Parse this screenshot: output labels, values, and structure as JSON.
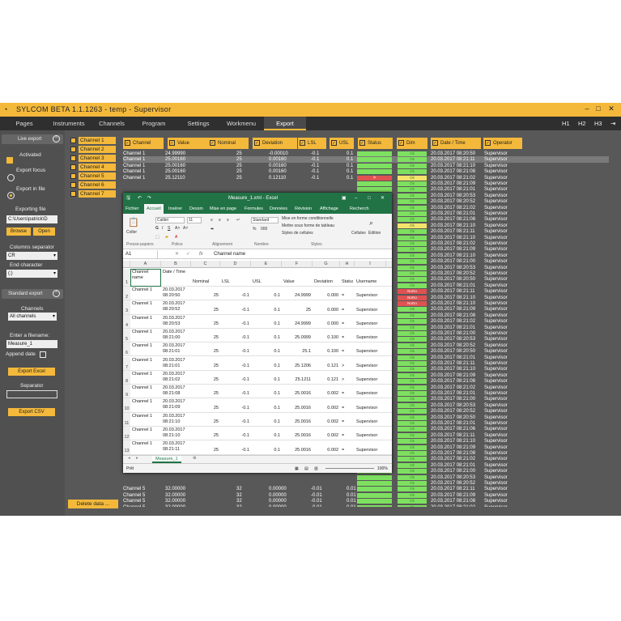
{
  "app": {
    "title": "SYLCOM BETA 1.1.1263  - temp - Supervisor"
  },
  "menu": {
    "items": [
      "Pages",
      "Instruments",
      "Channels",
      "Program",
      "Settings",
      "Workmenu",
      "Export"
    ],
    "active": "Export",
    "right": [
      "H1",
      "H2",
      "H3"
    ]
  },
  "left": {
    "live_export": "Live export",
    "activated": "Activated",
    "export_focus": "Export focus",
    "export_in_file": "Export in file",
    "exporting_file": "Exporting file",
    "file_path": "C:\\Users\\patrick\\D",
    "browse": "Browse",
    "open": "Open",
    "columns_separator": "Columns separator",
    "columns_value": "CR",
    "end_character": "End character",
    "end_value": "(;)",
    "standard_export": "Standard export",
    "channels": "Channels",
    "channels_value": "All channels",
    "enter_filename": "Enter a filename:",
    "filename": "Measure_1",
    "append_date": "Append date",
    "export_excel": "Export Excel",
    "separator": "Separator",
    "export_csv": "Export CSV"
  },
  "channels": [
    "Channel 1",
    "Channel 2",
    "Channel 3",
    "Channel 4",
    "Channel 5",
    "Channel 6",
    "Channel 7"
  ],
  "delete_button": "Delete data ...",
  "grid": {
    "headers": [
      "Channel",
      "Value",
      "Nominal",
      "Deviation",
      "LSL",
      "USL",
      "Status",
      "Dim",
      "Date / Time",
      "Operator"
    ],
    "top_rows": [
      [
        "Channel 1",
        "24.99990",
        "25",
        "-0.00010",
        "-0.1",
        "0.1",
        "ok",
        "20.03.2017 08:20:50",
        "Supervisor"
      ],
      [
        "Channel 1",
        "25.00160",
        "25",
        "0.00160",
        "-0.1",
        "0.1",
        "ok",
        "20.03.2017 08:21:11",
        "Supervisor"
      ],
      [
        "Channel 1",
        "25.00160",
        "25",
        "0.00160",
        "-0.1",
        "0.1",
        "ok",
        "20.03.2017 08:21:10",
        "Supervisor"
      ],
      [
        "Channel 1",
        "25.00160",
        "25",
        "0.00160",
        "-0.1",
        "0.1",
        "ok",
        "20.03.2017 08:21:08",
        "Supervisor"
      ],
      [
        "Channel 1",
        "25.12110",
        "25",
        "0.12110",
        "-0.1",
        "0.1",
        ">",
        "20.03.2017 08:21:02",
        "Supervisor"
      ]
    ],
    "status_gt": ">",
    "dim_ok": "Ok",
    "dim_nogo": "NoGo",
    "right_rows": [
      [
        "20.03.2017 08:21:09",
        "Supervisor"
      ],
      [
        "20.03.2017 08:21:01",
        "Supervisor"
      ],
      [
        "20.03.2017 08:20:53",
        "Supervisor"
      ],
      [
        "20.03.2017 08:20:52",
        "Supervisor"
      ],
      [
        "20.03.2017 08:21:02",
        "Supervisor"
      ],
      [
        "20.03.2017 08:21:01",
        "Supervisor"
      ],
      [
        "20.03.2017 08:21:08",
        "Supervisor"
      ],
      [
        "20.03.2017 08:21:10",
        "Supervisor"
      ],
      [
        "20.03.2017 08:21:11",
        "Supervisor"
      ],
      [
        "20.03.2017 08:21:10",
        "Supervisor"
      ],
      [
        "20.03.2017 08:21:02",
        "Supervisor"
      ],
      [
        "20.03.2017 08:21:09",
        "Supervisor"
      ],
      [
        "20.03.2017 08:21:10",
        "Supervisor"
      ],
      [
        "20.03.2017 08:21:00",
        "Supervisor"
      ],
      [
        "20.03.2017 08:20:53",
        "Supervisor"
      ],
      [
        "20.03.2017 08:20:52",
        "Supervisor"
      ],
      [
        "20.03.2017 08:20:50",
        "Supervisor"
      ],
      [
        "20.03.2017 08:21:01",
        "Supervisor"
      ],
      [
        "20.03.2017 08:21:11",
        "Supervisor"
      ],
      [
        "20.03.2017 08:21:10",
        "Supervisor"
      ],
      [
        "20.03.2017 08:21:10",
        "Supervisor"
      ],
      [
        "20.03.2017 08:21:09",
        "Supervisor"
      ],
      [
        "20.03.2017 08:21:08",
        "Supervisor"
      ],
      [
        "20.03.2017 08:21:02",
        "Supervisor"
      ],
      [
        "20.03.2017 08:21:01",
        "Supervisor"
      ],
      [
        "20.03.2017 08:21:00",
        "Supervisor"
      ],
      [
        "20.03.2017 08:20:53",
        "Supervisor"
      ],
      [
        "20.03.2017 08:20:52",
        "Supervisor"
      ],
      [
        "20.03.2017 08:20:50",
        "Supervisor"
      ],
      [
        "20.03.2017 08:21:01",
        "Supervisor"
      ],
      [
        "20.03.2017 08:21:11",
        "Supervisor"
      ],
      [
        "20.03.2017 08:21:10",
        "Supervisor"
      ],
      [
        "20.03.2017 08:21:09",
        "Supervisor"
      ],
      [
        "20.03.2017 08:21:08",
        "Supervisor"
      ],
      [
        "20.03.2017 08:21:02",
        "Supervisor"
      ],
      [
        "20.03.2017 08:21:01",
        "Supervisor"
      ],
      [
        "20.03.2017 08:21:00",
        "Supervisor"
      ],
      [
        "20.03.2017 08:20:53",
        "Supervisor"
      ],
      [
        "20.03.2017 08:20:52",
        "Supervisor"
      ],
      [
        "20.03.2017 08:20:50",
        "Supervisor"
      ],
      [
        "20.03.2017 08:21:01",
        "Supervisor"
      ],
      [
        "20.03.2017 08:21:06",
        "Supervisor"
      ],
      [
        "20.03.2017 08:21:11",
        "Supervisor"
      ],
      [
        "20.03.2017 08:21:10",
        "Supervisor"
      ],
      [
        "20.03.2017 08:21:09",
        "Supervisor"
      ],
      [
        "20.03.2017 08:21:08",
        "Supervisor"
      ],
      [
        "20.03.2017 08:21:02",
        "Supervisor"
      ],
      [
        "20.03.2017 08:21:01",
        "Supervisor"
      ],
      [
        "20.03.2017 08:21:00",
        "Supervisor"
      ],
      [
        "20.03.2017 08:20:53",
        "Supervisor"
      ],
      [
        "20.03.2017 08:20:52",
        "Supervisor"
      ]
    ],
    "bottom_rows": [
      [
        "Channel 5",
        "32.00000",
        "32",
        "0.00000",
        "-0.01",
        "0.01",
        "20.03.2017 08:21:11",
        "Supervisor"
      ],
      [
        "Channel 5",
        "32.00000",
        "32",
        "0.00000",
        "-0.01",
        "0.01",
        "20.03.2017 08:21:09",
        "Supervisor"
      ],
      [
        "Channel 5",
        "32.00000",
        "32",
        "0.00000",
        "-0.01",
        "0.01",
        "20.03.2017 08:21:08",
        "Supervisor"
      ],
      [
        "Channel 5",
        "32.00000",
        "32",
        "0.00000",
        "-0.01",
        "0.01",
        "20.03.2017 08:21:02",
        "Supervisor"
      ],
      [
        "Channel 5",
        "32.00000",
        "32",
        "0.00000",
        "-0.01",
        "0.01",
        "20.03.2017 08:21:01",
        "Supervisor"
      ],
      [
        "Channel 5",
        "32.00000",
        "32",
        "0.00000",
        "-0.01",
        "0.01",
        "20.03.2017 08:21:00",
        "Supervisor"
      ]
    ]
  },
  "excel": {
    "title": "Measure_1.xml - Excel",
    "tabs": [
      "Fichier",
      "Accueil",
      "Insérer",
      "Dessin",
      "Mise en page",
      "Formules",
      "Données",
      "Révision",
      "Affichage",
      "Recherch"
    ],
    "active_tab": "Accueil",
    "ribbon": {
      "paste": "Coller",
      "font": "Calibri",
      "size": "11",
      "format": "Standard",
      "cond": "Mise en forme conditionnelle",
      "table": "Mettre sous forme de tableau",
      "styles_btn": "Styles de cellules",
      "cells": "Cellules",
      "edit": "Édition",
      "g_clipboard": "Presse-papiers",
      "g_font": "Police",
      "g_align": "Alignement",
      "g_number": "Nombre",
      "g_styles": "Styles"
    },
    "cell_ref": "A1",
    "formula": "Channel name",
    "cols": [
      "A",
      "B",
      "C",
      "D",
      "E",
      "F",
      "G",
      "H",
      "I"
    ],
    "header": [
      "Channel name",
      "Date / Time",
      "Nominal",
      "LSL",
      "USL",
      "Value",
      "Deviation",
      "Status",
      "Username"
    ],
    "rows": [
      [
        "Channel 1",
        "20.03.2017 08:20:50",
        "25",
        "-0.1",
        "0.1",
        "24.9999",
        "0.000",
        "=",
        "Supervisor"
      ],
      [
        "Channel 1",
        "20.03.2017 08:20:52",
        "25",
        "-0.1",
        "0.1",
        "25",
        "0.000",
        "=",
        "Supervisor"
      ],
      [
        "Channel 1",
        "20.03.2017 08:20:53",
        "25",
        "-0.1",
        "0.1",
        "24.9999",
        "0.000",
        "=",
        "Supervisor"
      ],
      [
        "Channel 1",
        "20.03.2017 08:21:00",
        "25",
        "-0.1",
        "0.1",
        "25.0999",
        "0.100",
        "=",
        "Supervisor"
      ],
      [
        "Channel 1",
        "20.03.2017 08:21:01",
        "25",
        "-0.1",
        "0.1",
        "25.1",
        "0.100",
        "=",
        "Supervisor"
      ],
      [
        "Channel 1",
        "20.03.2017 08:21:01",
        "25",
        "-0.1",
        "0.1",
        "25.1206",
        "0.121",
        ">",
        "Supervisor"
      ],
      [
        "Channel 1",
        "20.03.2017 08:21:02",
        "25",
        "-0.1",
        "0.1",
        "25.1211",
        "0.121",
        ">",
        "Supervisor"
      ],
      [
        "Channel 1",
        "20.03.2017 08:21:08",
        "25",
        "-0.1",
        "0.1",
        "25.0016",
        "0.002",
        "=",
        "Supervisor"
      ],
      [
        "Channel 1",
        "20.03.2017 08:21:09",
        "25",
        "-0.1",
        "0.1",
        "25.0016",
        "0.002",
        "=",
        "Supervisor"
      ],
      [
        "Channel 1",
        "20.03.2017 08:21:10",
        "25",
        "-0.1",
        "0.1",
        "25.0016",
        "0.002",
        "=",
        "Supervisor"
      ],
      [
        "Channel 1",
        "20.03.2017 08:21:10",
        "25",
        "-0.1",
        "0.1",
        "25.0016",
        "0.002",
        "=",
        "Supervisor"
      ],
      [
        "Channel 1",
        "20.03.2017 08:21:11",
        "25",
        "-0.1",
        "0.1",
        "25.0016",
        "0.002",
        "=",
        "Supervisor"
      ]
    ],
    "sheet": "Measure_1",
    "status_left": "Prêt",
    "zoom": "100%"
  },
  "colors": {
    "accent": "#f4b93b",
    "bg": "#585858",
    "ok": "#7ee060",
    "nogo": "#e05252",
    "excel": "#217346"
  }
}
